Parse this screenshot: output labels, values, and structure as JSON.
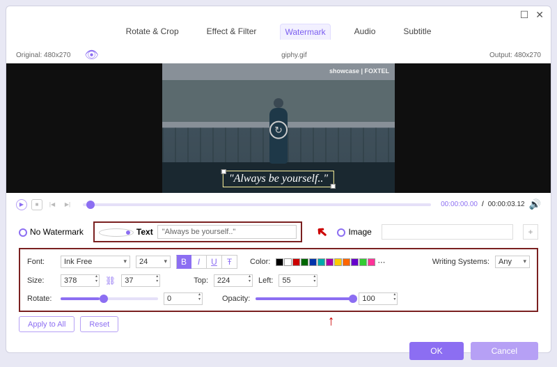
{
  "window": {
    "title": "giphy.gif",
    "maximize": "☐",
    "close": "✕"
  },
  "tabs": [
    "Rotate & Crop",
    "Effect & Filter",
    "Watermark",
    "Audio",
    "Subtitle"
  ],
  "active_tab": 2,
  "info": {
    "original": "Original: 480x270",
    "output": "Output: 480x270"
  },
  "preview": {
    "brand": "showcase | FOXTEL",
    "watermark_text": "\"Always be yourself..\""
  },
  "playback": {
    "position_pct": 1,
    "time_current": "00:00:00.00",
    "time_total": "00:00:03.12"
  },
  "watermark": {
    "options": {
      "none": "No Watermark",
      "text": "Text",
      "image": "Image"
    },
    "selected": "text",
    "text_value": "\"Always be yourself..\""
  },
  "font_row": {
    "font_label": "Font:",
    "font_value": "Ink Free",
    "size_value": "24",
    "bold": "B",
    "italic": "I",
    "underline": "U",
    "strike": "Ŧ",
    "color_label": "Color:",
    "ws_label": "Writing Systems:",
    "ws_value": "Any"
  },
  "colors": [
    "#000000",
    "#ffffff",
    "#cc0000",
    "#006600",
    "#0033aa",
    "#00aaaa",
    "#aa00aa",
    "#ffcc00",
    "#ff6600",
    "#6600cc",
    "#33cc33",
    "#ff3399"
  ],
  "size_row": {
    "size_label": "Size:",
    "w": "378",
    "h": "37",
    "top_label": "Top:",
    "top": "224",
    "left_label": "Left:",
    "left": "55"
  },
  "rotate_row": {
    "rotate_label": "Rotate:",
    "rotate_val": "0",
    "rotate_pct": 40,
    "opacity_label": "Opacity:",
    "opacity_val": "100",
    "opacity_pct": 100
  },
  "actions": {
    "apply_all": "Apply to All",
    "reset": "Reset",
    "ok": "OK",
    "cancel": "Cancel"
  }
}
